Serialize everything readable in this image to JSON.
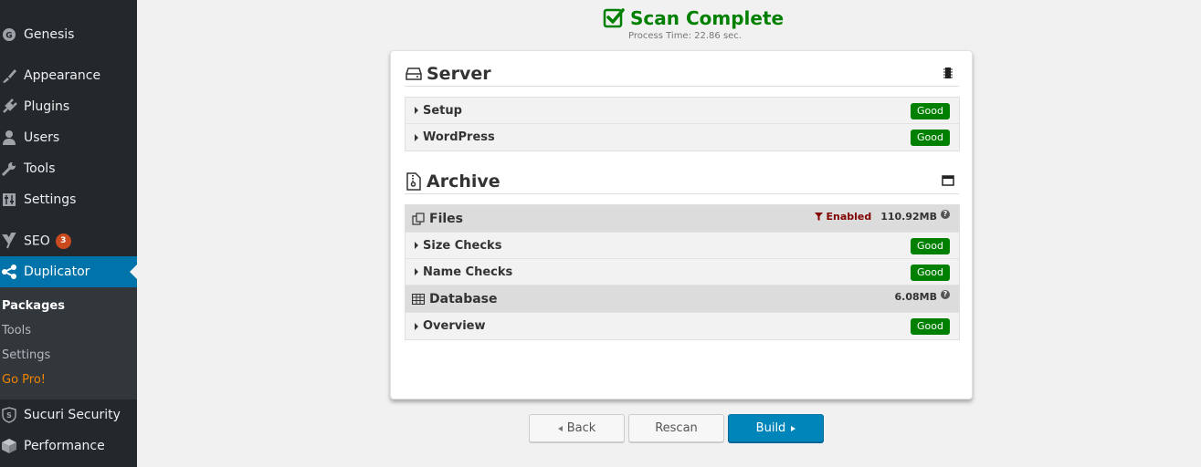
{
  "sidebar": {
    "items": [
      {
        "label": "Genesis",
        "icon": "genesis-icon"
      },
      {
        "label": "Appearance",
        "icon": "paintbrush-icon"
      },
      {
        "label": "Plugins",
        "icon": "plugin-icon"
      },
      {
        "label": "Users",
        "icon": "user-icon"
      },
      {
        "label": "Tools",
        "icon": "wrench-icon"
      },
      {
        "label": "Settings",
        "icon": "sliders-icon"
      },
      {
        "label": "SEO",
        "icon": "yoast-icon",
        "badge": "3"
      },
      {
        "label": "Duplicator",
        "icon": "share-icon"
      },
      {
        "label": "Sucuri Security",
        "icon": "shield-icon"
      },
      {
        "label": "Performance",
        "icon": "cube-icon"
      }
    ],
    "submenu": [
      "Packages",
      "Tools",
      "Settings",
      "Go Pro!"
    ]
  },
  "header": {
    "title": "Scan Complete",
    "process_time": "Process Time: 22.86 sec."
  },
  "server": {
    "title": "Server",
    "rows": [
      {
        "label": "Setup",
        "status": "Good"
      },
      {
        "label": "WordPress",
        "status": "Good"
      }
    ]
  },
  "archive": {
    "title": "Archive",
    "files": {
      "label": "Files",
      "filter": "Enabled",
      "size": "110.92MB",
      "rows": [
        {
          "label": "Size Checks",
          "status": "Good"
        },
        {
          "label": "Name Checks",
          "status": "Good"
        }
      ]
    },
    "database": {
      "label": "Database",
      "size": "6.08MB",
      "rows": [
        {
          "label": "Overview",
          "status": "Good"
        }
      ]
    }
  },
  "buttons": {
    "back": "Back",
    "rescan": "Rescan",
    "build": "Build"
  },
  "colors": {
    "accent": "#0073aa",
    "good": "#008000",
    "sidebar": "#23282d"
  }
}
